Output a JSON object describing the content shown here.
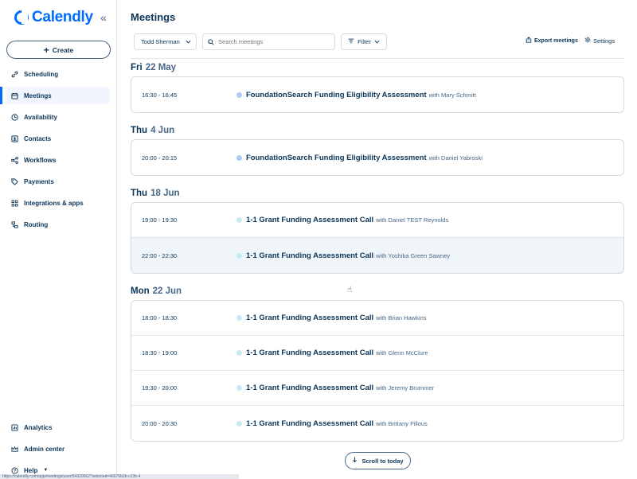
{
  "brand": {
    "name": "Calendly",
    "accent": "#006bff",
    "text_primary": "#0b3558",
    "text_secondary": "#476788"
  },
  "sidebar": {
    "create_label": "Create",
    "items": [
      {
        "label": "Scheduling",
        "icon": "link-icon"
      },
      {
        "label": "Meetings",
        "icon": "calendar-icon",
        "active": true
      },
      {
        "label": "Availability",
        "icon": "clock-icon"
      },
      {
        "label": "Contacts",
        "icon": "contacts-icon"
      },
      {
        "label": "Workflows",
        "icon": "workflows-icon"
      },
      {
        "label": "Payments",
        "icon": "tag-icon"
      },
      {
        "label": "Integrations & apps",
        "icon": "grid-icon"
      },
      {
        "label": "Routing",
        "icon": "routing-icon"
      }
    ],
    "bottom_items": [
      {
        "label": "Analytics",
        "icon": "analytics-icon"
      },
      {
        "label": "Admin center",
        "icon": "crown-icon"
      },
      {
        "label": "Help",
        "icon": "help-icon"
      }
    ]
  },
  "header": {
    "title": "Meetings"
  },
  "toolbar": {
    "user_select": "Todd Sherman",
    "search_placeholder": "Search meetings",
    "filter_label": "Filter",
    "export_label": "Export meetings",
    "settings_label": "Settings"
  },
  "days": [
    {
      "weekday": "Fri",
      "date": "22 May",
      "meetings": [
        {
          "time": "16:30 - 16:45",
          "title": "FoundationSearch Funding Eligibility Assessment",
          "with": "with Mary Schmitt",
          "dot": "#a9cdf7"
        }
      ]
    },
    {
      "weekday": "Thu",
      "date": "4 Jun",
      "meetings": [
        {
          "time": "20:00 - 20:15",
          "title": "FoundationSearch Funding Eligibility Assessment",
          "with": "with Daniel Yabroski",
          "dot": "#a9cdf7"
        }
      ]
    },
    {
      "weekday": "Thu",
      "date": "18 Jun",
      "meetings": [
        {
          "time": "19:00 - 19:30",
          "title": "1-1 Grant Funding Assessment Call",
          "with": "with Daniel TEST Reynolds",
          "dot": "#c3ecf3"
        },
        {
          "time": "22:00 - 22:30",
          "title": "1-1 Grant Funding Assessment Call",
          "with": "with Yoshika Green Sawney",
          "dot": "#c3ecf3",
          "hover": true
        }
      ]
    },
    {
      "weekday": "Mon",
      "date": "22 Jun",
      "meetings": [
        {
          "time": "18:00 - 18:30",
          "title": "1-1 Grant Funding Assessment Call",
          "with": "with Brian Hawkins",
          "dot": "#c3ecf3"
        },
        {
          "time": "18:30 - 19:00",
          "title": "1-1 Grant Funding Assessment Call",
          "with": "with Glenn McClure",
          "dot": "#c3ecf3"
        },
        {
          "time": "19:30 - 20:00",
          "title": "1-1 Grant Funding Assessment Call",
          "with": "with Jeremy Brummer",
          "dot": "#c3ecf3"
        },
        {
          "time": "20:00 - 20:30",
          "title": "1-1 Grant Funding Assessment Call",
          "with": "with Brittany Fillous",
          "dot": "#c3ecf3"
        }
      ]
    }
  ],
  "scroll_today_label": "Scroll to today",
  "status_url": "https://calendly.com/app/meetings/user/54320062?selected=46676b2b-c23b-4"
}
